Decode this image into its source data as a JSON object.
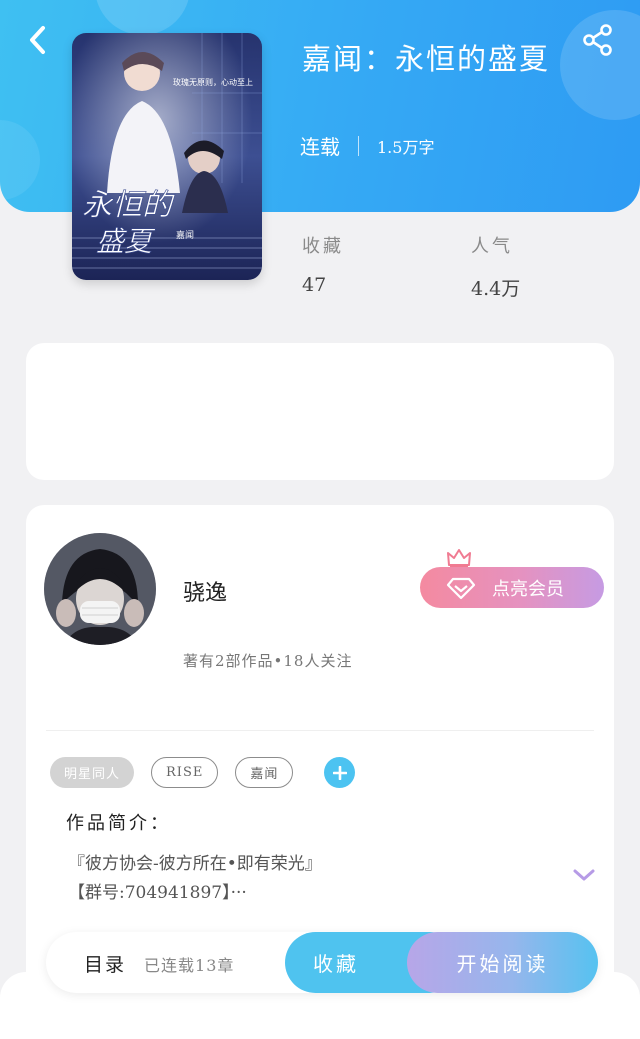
{
  "book": {
    "title": "嘉闻：永恒的盛夏",
    "status": "连载",
    "word_count": "1.5万字",
    "cover_tagline": "玫瑰无原则，心动至上",
    "cover_title_line1": "永恒的",
    "cover_title_line2": "盛夏",
    "cover_side_text": "嘉闻"
  },
  "stats": {
    "favorites_label": "收藏",
    "favorites_value": "47",
    "popularity_label": "人气",
    "popularity_value": "4.4万"
  },
  "author": {
    "name": "骁逸",
    "stats": "著有2部作品•18人关注",
    "vip_label": "点亮会员"
  },
  "tags": [
    "明星同人",
    "RISE",
    "嘉闻"
  ],
  "intro": {
    "label": "作品简介：",
    "line1": "『彼方协会-彼方所在•即有荣光』",
    "line2": "【群号:704941897】···"
  },
  "bottom_bar": {
    "toc_label": "目录",
    "toc_count": "已连载13章",
    "favorite_label": "收藏",
    "read_label": "开始阅读"
  },
  "colors": {
    "header_blue": "#35a9f4",
    "accent_cyan": "#4fc3ef",
    "vip_pink": "#f48aa0",
    "vip_purple": "#c69be3",
    "expand_purple": "#b69be6"
  },
  "icons": {
    "back": "chevron-left-icon",
    "share": "share-icon",
    "vip": "diamond-icon",
    "crown": "crown-icon",
    "add_tag": "plus-icon",
    "expand": "chevron-down-icon"
  }
}
